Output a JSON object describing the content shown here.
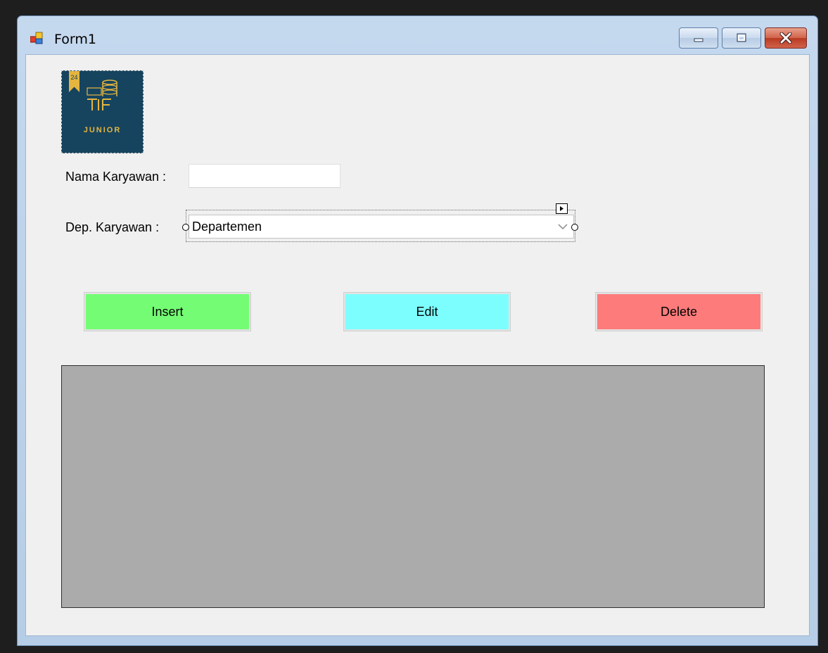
{
  "window": {
    "title": "Form1",
    "controls": [
      "minimize-icon",
      "maximize-icon",
      "close-icon"
    ]
  },
  "logo": {
    "badge": "24",
    "word": "JUNIOR"
  },
  "form": {
    "nama_label": "Nama Karyawan :",
    "nama_value": "",
    "dep_label": "Dep. Karyawan :",
    "dep_selected": "Departemen"
  },
  "buttons": {
    "insert": "Insert",
    "edit": "Edit",
    "delete": "Delete"
  },
  "colors": {
    "insert": "#74fd74",
    "edit": "#7dfefe",
    "delete": "#fd7b7b",
    "grid_background": "#ababab",
    "logo_background": "#16445f",
    "logo_accent": "#e5b53f"
  }
}
